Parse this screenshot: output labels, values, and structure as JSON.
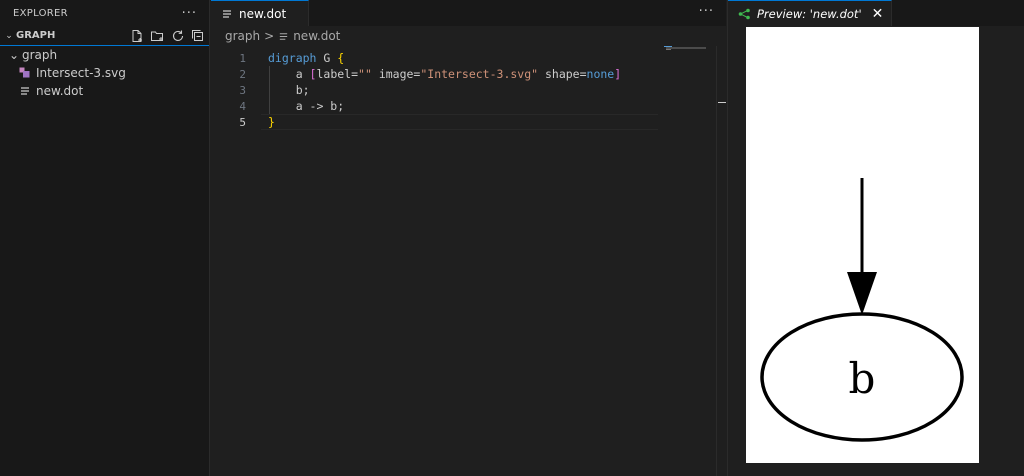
{
  "explorer": {
    "title": "EXPLORER",
    "more": "···",
    "section": "GRAPH",
    "folder": "graph",
    "files": [
      {
        "name": "Intersect-3.svg",
        "icon": "svg-file-icon"
      },
      {
        "name": "new.dot",
        "icon": "text-file-icon"
      }
    ]
  },
  "editor": {
    "tab_label": "new.dot",
    "more": "···",
    "breadcrumb": {
      "folder": "graph",
      "separator": ">",
      "file": "new.dot"
    },
    "lines": [
      {
        "num": "1",
        "segments": [
          [
            "kw",
            "digraph"
          ],
          [
            "id",
            " G "
          ],
          [
            "br",
            "{"
          ]
        ]
      },
      {
        "num": "2",
        "segments": [
          [
            "id",
            "    a "
          ],
          [
            "br2",
            "["
          ],
          [
            "attr",
            "label="
          ],
          [
            "str",
            "\"\""
          ],
          [
            "attr",
            " image="
          ],
          [
            "str",
            "\"Intersect-3.svg\""
          ],
          [
            "attr",
            " shape="
          ],
          [
            "kw",
            "none"
          ],
          [
            "br2",
            "]"
          ]
        ]
      },
      {
        "num": "3",
        "segments": [
          [
            "id",
            "    b;"
          ]
        ]
      },
      {
        "num": "4",
        "segments": [
          [
            "id",
            "    a -> b;"
          ]
        ]
      },
      {
        "num": "5",
        "segments": [
          [
            "br",
            "}"
          ]
        ]
      }
    ]
  },
  "preview": {
    "tab_label": "Preview: 'new.dot'",
    "close": "✕",
    "node_label": "b"
  },
  "colors": {
    "accent": "#0078d4",
    "keyword": "#569cd6",
    "string": "#ce9178",
    "bracket": "#ffd700",
    "bracket2": "#da70d6"
  }
}
